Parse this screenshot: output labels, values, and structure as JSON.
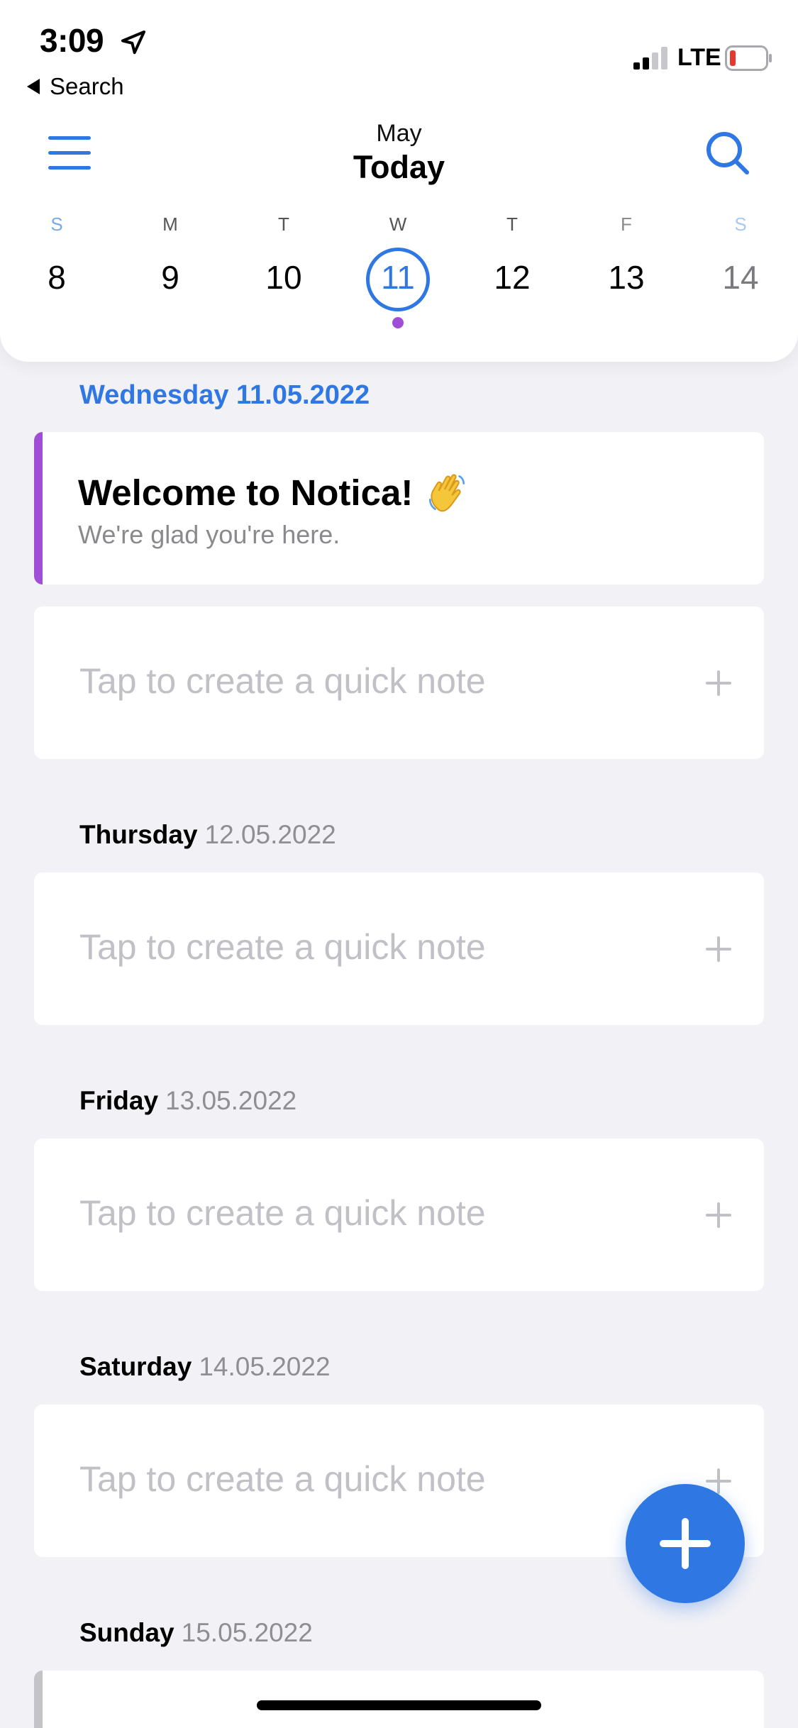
{
  "status_bar": {
    "time": "3:09",
    "back_label": "Search",
    "network": "LTE"
  },
  "header": {
    "month": "May",
    "title": "Today"
  },
  "week": {
    "days": [
      {
        "letter": "S",
        "number": "8"
      },
      {
        "letter": "M",
        "number": "9"
      },
      {
        "letter": "T",
        "number": "10"
      },
      {
        "letter": "W",
        "number": "11",
        "selected": true,
        "has_note": true
      },
      {
        "letter": "T",
        "number": "12"
      },
      {
        "letter": "F",
        "number": "13"
      },
      {
        "letter": "S",
        "number": "14"
      }
    ]
  },
  "sections": [
    {
      "day": "Wednesday",
      "date": "11.05.2022",
      "full": "Wednesday 11.05.2022"
    },
    {
      "day": "Thursday",
      "date": "12.05.2022"
    },
    {
      "day": "Friday",
      "date": "13.05.2022"
    },
    {
      "day": "Saturday",
      "date": "14.05.2022"
    },
    {
      "day": "Sunday",
      "date": "15.05.2022"
    }
  ],
  "welcome_note": {
    "title": "Welcome to Notica!",
    "subtitle": "We're glad you're here."
  },
  "quick_note_placeholder": "Tap to create a quick note",
  "icons": {
    "menu": "hamburger-menu-icon",
    "search": "search-icon",
    "add": "plus-icon",
    "location": "location-arrow-icon",
    "wave": "waving-hand-emoji"
  },
  "colors": {
    "accent": "#2f78e4",
    "note_bar": "#a04ed8",
    "background": "#f1f1f6",
    "placeholder": "#c0c0c6"
  }
}
